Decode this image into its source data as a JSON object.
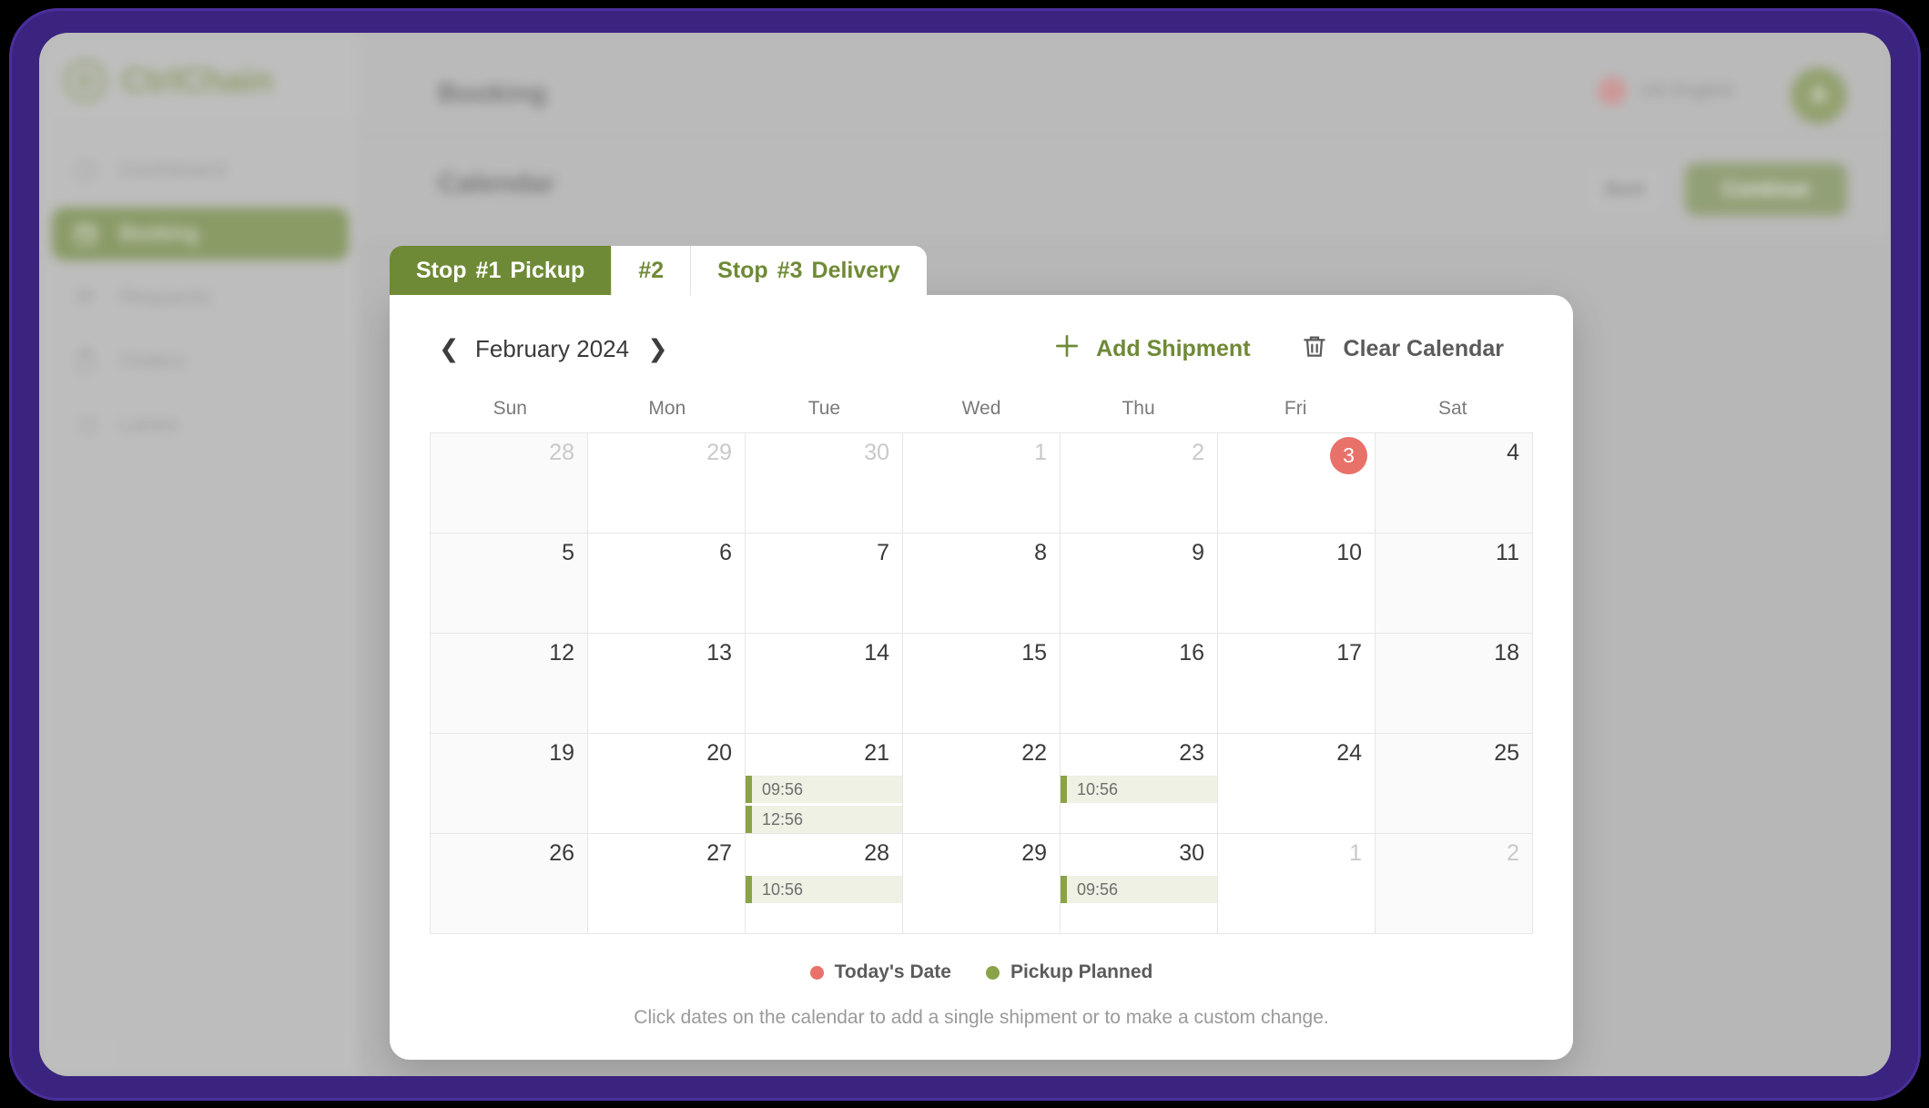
{
  "app": {
    "brand": "CtrlChain",
    "brand_color": "#7b9141",
    "accent_color": "#6f8a36",
    "frame_color": "#3b2380",
    "today_color": "#e8716a"
  },
  "sidebar": {
    "items": [
      {
        "label": "Dashboard",
        "icon": "dashboard-icon",
        "active": false
      },
      {
        "label": "Booking",
        "icon": "calendar-cursor-icon",
        "active": true
      },
      {
        "label": "Requests",
        "icon": "people-icon",
        "active": false
      },
      {
        "label": "Orders",
        "icon": "clipboard-icon",
        "active": false
      },
      {
        "label": "Lanes",
        "icon": "lanes-icon",
        "active": false
      }
    ]
  },
  "topbar": {
    "title": "Booking",
    "language": "US English",
    "avatar_initial": "A"
  },
  "subbar": {
    "section_title": "Calendar",
    "back_label": "Back",
    "continue_label": "Continue"
  },
  "tabs": [
    {
      "prefix": "Stop",
      "number": "#1",
      "suffix": "Pickup",
      "active": true
    },
    {
      "prefix": "",
      "number": "#2",
      "suffix": "",
      "active": false
    },
    {
      "prefix": "Stop",
      "number": "#3",
      "suffix": "Delivery",
      "active": false
    }
  ],
  "calendar": {
    "month_label": "February 2024",
    "prev_icon": "chevron-left-icon",
    "next_icon": "chevron-right-icon",
    "add_shipment_label": "Add Shipment",
    "clear_calendar_label": "Clear Calendar",
    "day_headers": [
      "Sun",
      "Mon",
      "Tue",
      "Wed",
      "Thu",
      "Fri",
      "Sat"
    ],
    "weeks": [
      [
        {
          "day": "28",
          "out": true,
          "today": false,
          "events": []
        },
        {
          "day": "29",
          "out": true,
          "today": false,
          "events": []
        },
        {
          "day": "30",
          "out": true,
          "today": false,
          "events": []
        },
        {
          "day": "1",
          "out": true,
          "today": false,
          "events": []
        },
        {
          "day": "2",
          "out": true,
          "today": false,
          "events": []
        },
        {
          "day": "3",
          "out": false,
          "today": true,
          "events": []
        },
        {
          "day": "4",
          "out": false,
          "today": false,
          "events": []
        }
      ],
      [
        {
          "day": "5",
          "out": false,
          "today": false,
          "events": []
        },
        {
          "day": "6",
          "out": false,
          "today": false,
          "events": []
        },
        {
          "day": "7",
          "out": false,
          "today": false,
          "events": []
        },
        {
          "day": "8",
          "out": false,
          "today": false,
          "events": []
        },
        {
          "day": "9",
          "out": false,
          "today": false,
          "events": []
        },
        {
          "day": "10",
          "out": false,
          "today": false,
          "events": []
        },
        {
          "day": "11",
          "out": false,
          "today": false,
          "events": []
        }
      ],
      [
        {
          "day": "12",
          "out": false,
          "today": false,
          "events": []
        },
        {
          "day": "13",
          "out": false,
          "today": false,
          "events": []
        },
        {
          "day": "14",
          "out": false,
          "today": false,
          "events": []
        },
        {
          "day": "15",
          "out": false,
          "today": false,
          "events": []
        },
        {
          "day": "16",
          "out": false,
          "today": false,
          "events": []
        },
        {
          "day": "17",
          "out": false,
          "today": false,
          "events": []
        },
        {
          "day": "18",
          "out": false,
          "today": false,
          "events": []
        }
      ],
      [
        {
          "day": "19",
          "out": false,
          "today": false,
          "events": []
        },
        {
          "day": "20",
          "out": false,
          "today": false,
          "events": []
        },
        {
          "day": "21",
          "out": false,
          "today": false,
          "events": [
            "09:56",
            "12:56"
          ]
        },
        {
          "day": "22",
          "out": false,
          "today": false,
          "events": []
        },
        {
          "day": "23",
          "out": false,
          "today": false,
          "events": [
            "10:56"
          ]
        },
        {
          "day": "24",
          "out": false,
          "today": false,
          "events": []
        },
        {
          "day": "25",
          "out": false,
          "today": false,
          "events": []
        }
      ],
      [
        {
          "day": "26",
          "out": false,
          "today": false,
          "events": []
        },
        {
          "day": "27",
          "out": false,
          "today": false,
          "events": []
        },
        {
          "day": "28",
          "out": false,
          "today": false,
          "events": [
            "10:56"
          ]
        },
        {
          "day": "29",
          "out": false,
          "today": false,
          "events": []
        },
        {
          "day": "30",
          "out": false,
          "today": false,
          "events": [
            "09:56"
          ]
        },
        {
          "day": "1",
          "out": true,
          "today": false,
          "events": []
        },
        {
          "day": "2",
          "out": true,
          "today": false,
          "events": []
        }
      ]
    ],
    "legend": [
      {
        "label": "Today's Date",
        "color": "red"
      },
      {
        "label": "Pickup Planned",
        "color": "green"
      }
    ],
    "hint": "Click dates on the calendar to add a single shipment or to make a custom change."
  }
}
